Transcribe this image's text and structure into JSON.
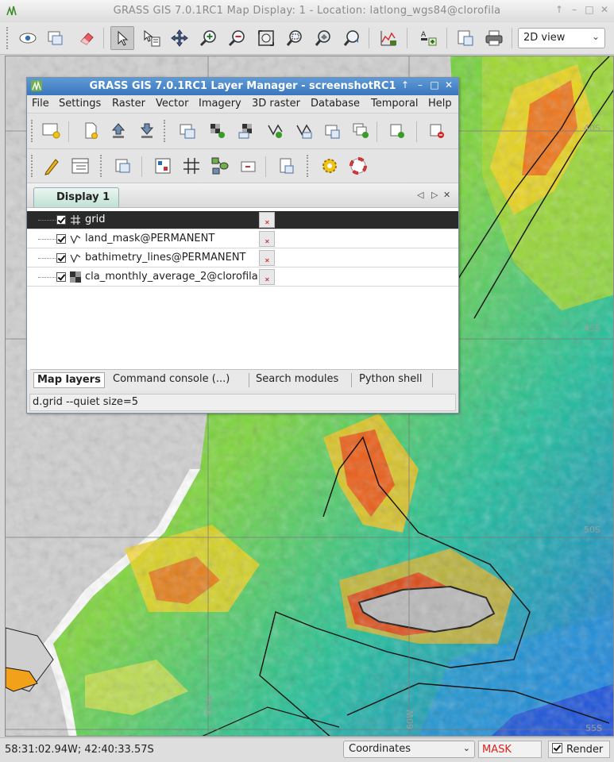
{
  "map_window": {
    "title": "GRASS GIS 7.0.1RC1 Map Display: 1  - Location: latlong_wgs84@clorofila",
    "view_mode": "2D view",
    "grid_labels": [
      "40S",
      "45S",
      "50S",
      "55S",
      "65W",
      "60W"
    ]
  },
  "map_toolbar": {
    "icons": [
      "display-icon",
      "render-icon",
      "erase-icon",
      "pointer-icon",
      "query-icon",
      "pan-icon",
      "zoom-in-icon",
      "zoom-out-icon",
      "zoom-extent-icon",
      "zoom-region-icon",
      "zoom-layer-icon",
      "zoom-back-icon",
      "analyze-icon",
      "decoration-icon",
      "save-image-icon",
      "print-icon"
    ]
  },
  "layer_manager": {
    "title": "GRASS GIS 7.0.1RC1 Layer Manager - screenshotRC1",
    "menus": [
      "File",
      "Settings",
      "Raster",
      "Vector",
      "Imagery",
      "3D raster",
      "Database",
      "Temporal",
      "Help"
    ],
    "display_tab": "Display 1",
    "layers": [
      {
        "name": "grid",
        "checked": true,
        "type": "grid"
      },
      {
        "name": "land_mask@PERMANENT",
        "checked": true,
        "type": "vector"
      },
      {
        "name": "bathimetry_lines@PERMANENT",
        "checked": true,
        "type": "vector"
      },
      {
        "name": "cla_monthly_average_2@clorofila",
        "checked": true,
        "type": "raster"
      }
    ],
    "bottom_tabs": [
      "Map layers",
      "Command console (...)",
      "Search modules",
      "Python shell"
    ],
    "command": "d.grid --quiet size=5"
  },
  "statusbar": {
    "coordinates": "58:31:02.94W; 42:40:33.57S",
    "mode": "Coordinates",
    "mask": "MASK",
    "render_label": "Render",
    "render_checked": true
  },
  "colors": {
    "title_active": "#3a76bd",
    "mask_text": "#e02020"
  }
}
